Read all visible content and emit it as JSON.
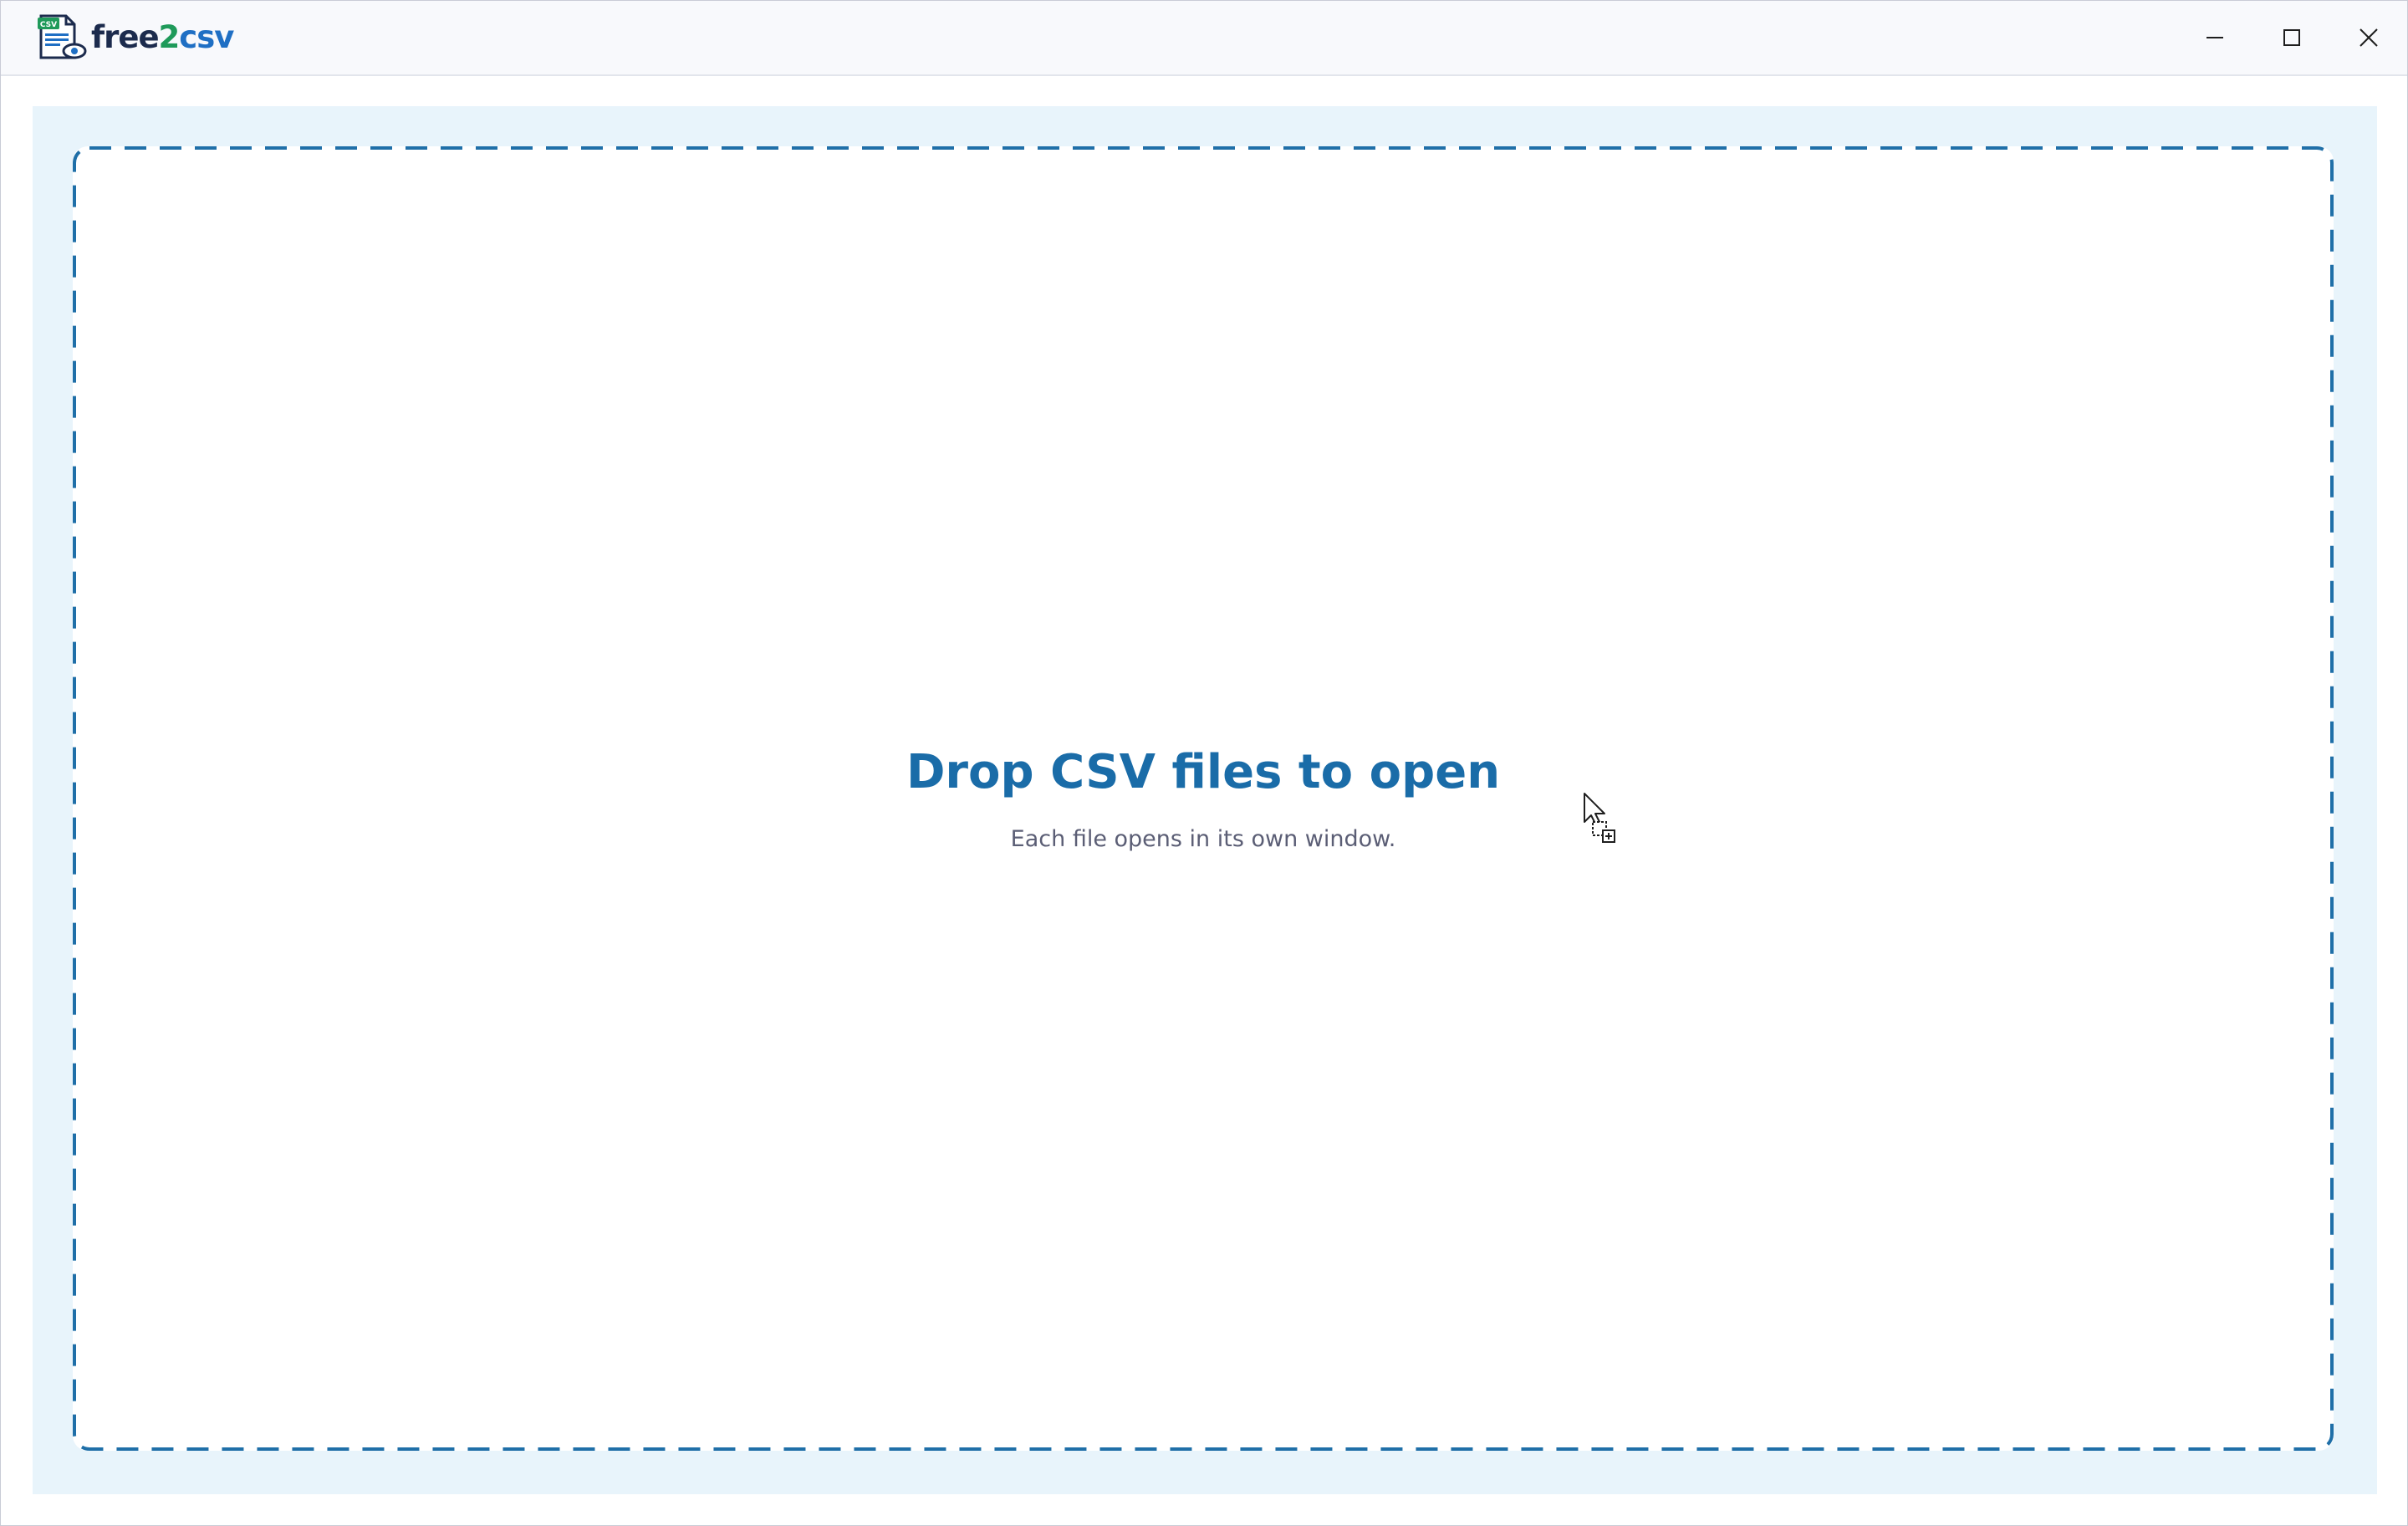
{
  "titlebar": {
    "logo": {
      "badge": "CSV",
      "text_part1": "free",
      "text_part2": "2",
      "text_part3": "csv"
    },
    "controls": {
      "minimize_icon": "minimize-icon",
      "maximize_icon": "maximize-icon",
      "close_icon": "close-icon"
    }
  },
  "dropzone": {
    "title": "Drop CSV files to open",
    "subtitle": "Each file opens in its own window."
  },
  "cursor": {
    "icon": "drag-copy-cursor-icon"
  },
  "colors": {
    "accent": "#1a6ca8",
    "dropzone_border": "#1f6fa8",
    "panel_bg": "#e8f4fb",
    "subtitle": "#5b5e75",
    "logo_green": "#1f9a5a",
    "logo_blue": "#1f6fc4",
    "logo_dark": "#1c2b4d"
  }
}
